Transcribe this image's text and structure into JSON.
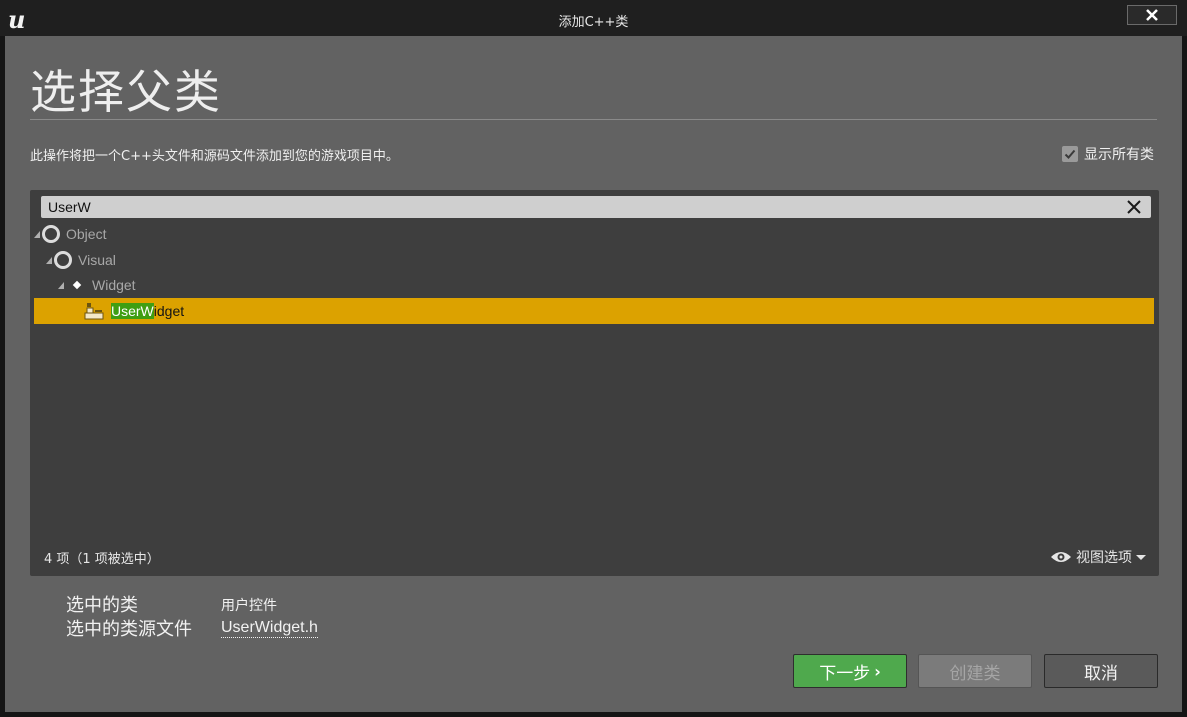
{
  "window": {
    "title": "添加C++类",
    "logo_icon": "unreal-engine-logo",
    "close_icon": "close-icon"
  },
  "page": {
    "heading": "选择父类",
    "description": "此操作将把一个C++头文件和源码文件添加到您的游戏项目中。",
    "show_all_classes": {
      "label": "显示所有类",
      "checked": true
    }
  },
  "class_picker": {
    "search": {
      "value": "UserW",
      "clear_icon": "clear-search-icon"
    },
    "tree": [
      {
        "label": "Object",
        "icon": "class-ring-icon",
        "expanded": true
      },
      {
        "label": "Visual",
        "icon": "class-ring-icon",
        "expanded": true
      },
      {
        "label": "Widget",
        "icon": "diamond-icon",
        "expanded": true
      },
      {
        "label_match": "UserW",
        "label_rest": "idget",
        "icon": "widget-class-icon",
        "selected": true
      }
    ],
    "status": "4 项（1 项被选中）",
    "view_options": "视图选项"
  },
  "selection_info": {
    "class_label": "选中的类",
    "class_value": "用户控件",
    "source_label": "选中的类源文件",
    "source_value": "UserWidget.h"
  },
  "buttons": {
    "next": "下一步",
    "create": "创建类",
    "cancel": "取消"
  },
  "colors": {
    "selection": "#dca200",
    "match_highlight": "#3f9e12",
    "next_button": "#4fa94d"
  }
}
